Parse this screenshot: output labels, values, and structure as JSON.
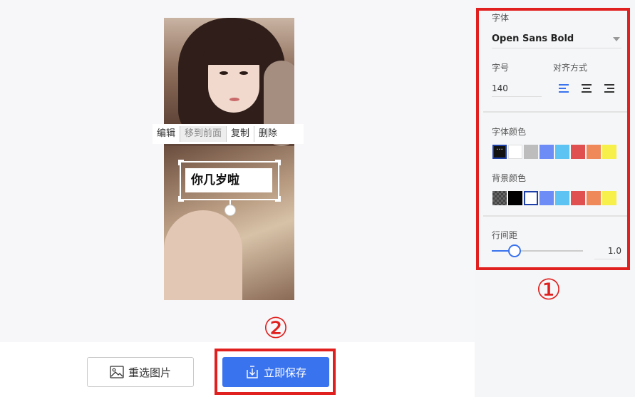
{
  "context_menu": {
    "edit": "编辑",
    "bring_front": "移到前面",
    "copy": "复制",
    "delete": "删除"
  },
  "textbox": {
    "text": "你几岁啦"
  },
  "bottom": {
    "reselect_label": "重选图片",
    "save_label": "立即保存"
  },
  "markers": {
    "one": "①",
    "two": "②"
  },
  "panel": {
    "font_label": "字体",
    "font_value": "Open Sans Bold",
    "size_label": "字号",
    "size_value": "140",
    "align_label": "对齐方式",
    "font_color_label": "字体颜色",
    "bg_color_label": "背景颜色",
    "line_spacing_label": "行间距",
    "line_spacing_value": "1.0",
    "line_spacing_slider_fraction": 0.25
  },
  "font_colors": [
    "#111111",
    "#ffffff",
    "#bdbdbd",
    "#6e8cf5",
    "#5cc3f2",
    "#e05050",
    "#f0895a",
    "#f7f04a"
  ],
  "bg_colors": [
    "transparent",
    "#000000",
    "#ffffff",
    "#6e8cf5",
    "#5cc3f2",
    "#e05050",
    "#f0895a",
    "#f7f04a"
  ],
  "accent_color": "#3a73ee",
  "annotation_color": "#e0201e"
}
